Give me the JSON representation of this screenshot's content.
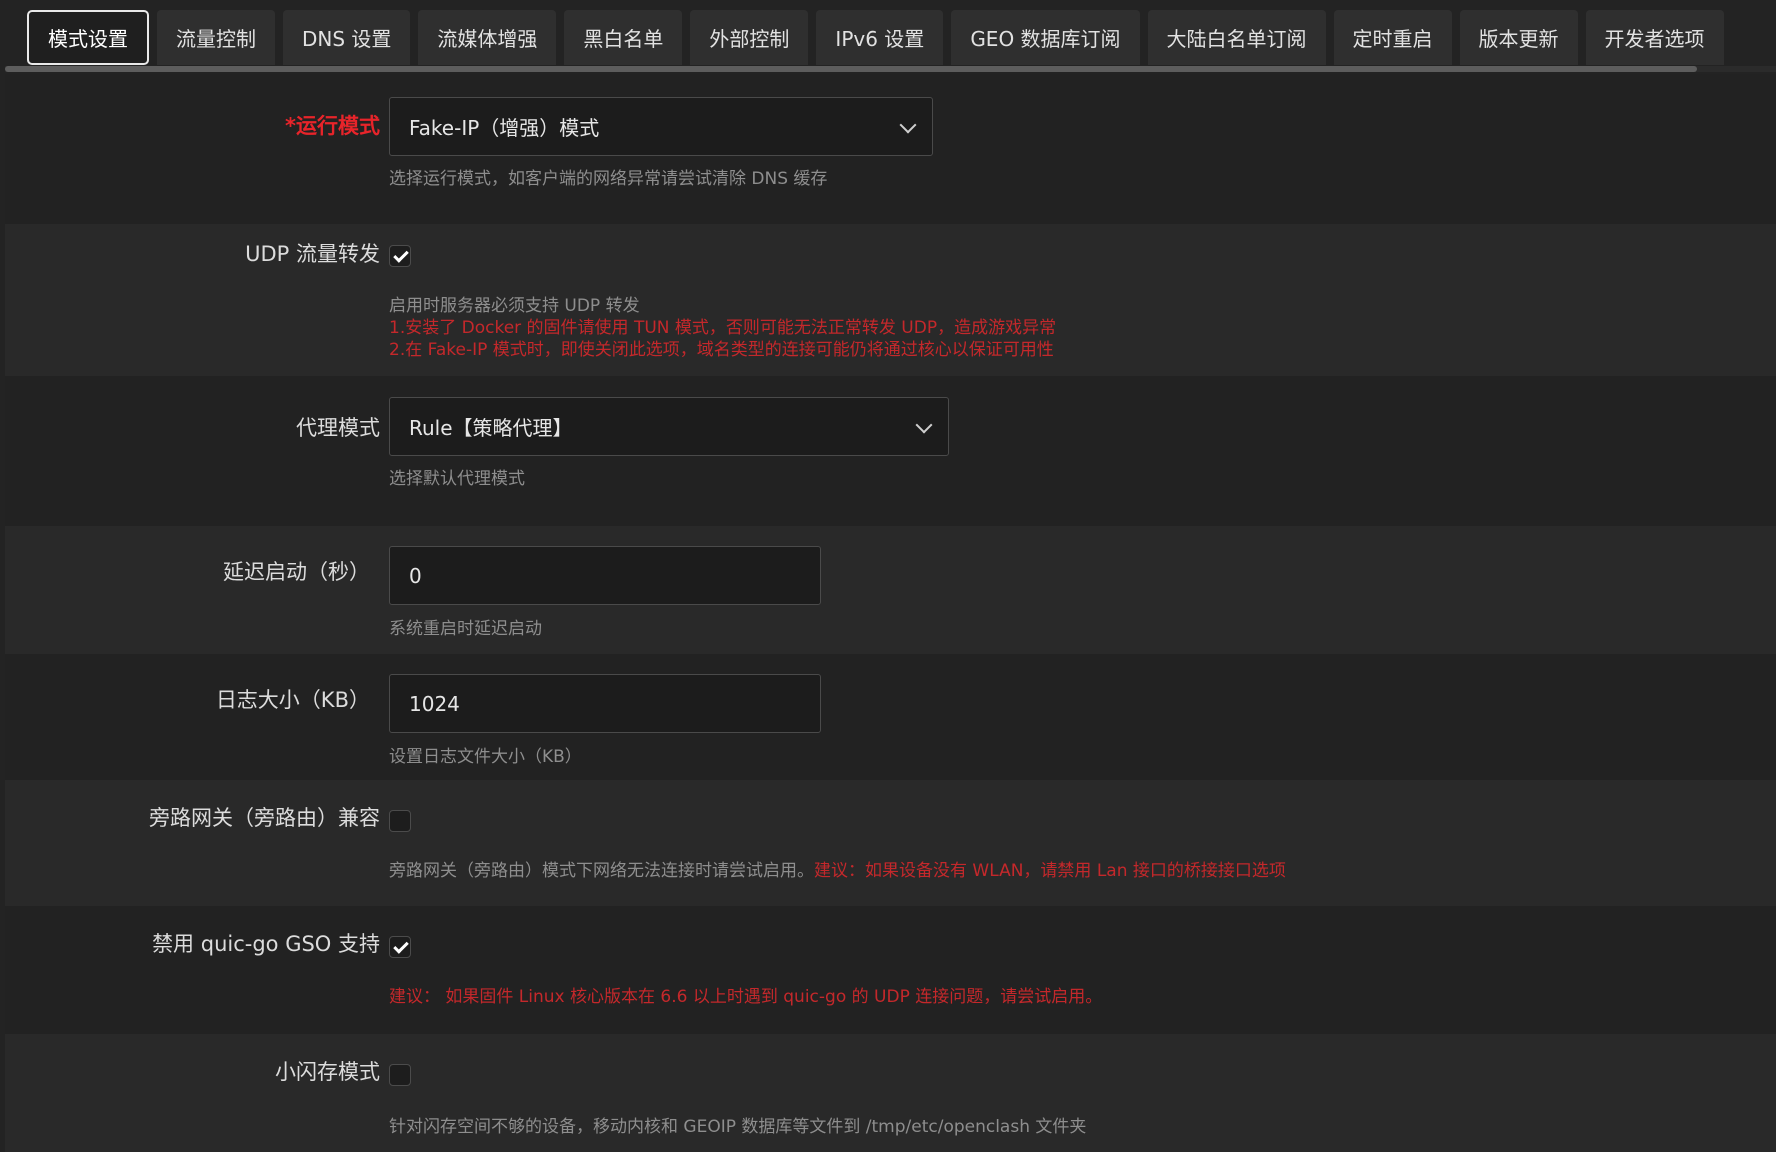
{
  "tabs": [
    {
      "label": "模式设置",
      "active": true
    },
    {
      "label": "流量控制",
      "active": false
    },
    {
      "label": "DNS 设置",
      "active": false
    },
    {
      "label": "流媒体增强",
      "active": false
    },
    {
      "label": "黑白名单",
      "active": false
    },
    {
      "label": "外部控制",
      "active": false
    },
    {
      "label": "IPv6 设置",
      "active": false
    },
    {
      "label": "GEO 数据库订阅",
      "active": false
    },
    {
      "label": "大陆白名单订阅",
      "active": false
    },
    {
      "label": "定时重启",
      "active": false
    },
    {
      "label": "版本更新",
      "active": false
    },
    {
      "label": "开发者选项",
      "active": false
    }
  ],
  "settings": {
    "run_mode": {
      "label": "*运行模式",
      "value": "Fake-IP（增强）模式",
      "desc": "选择运行模式，如客户端的网络异常请尝试清除 DNS 缓存"
    },
    "udp_forward": {
      "label": "UDP 流量转发",
      "checked": true,
      "desc": "启用时服务器必须支持 UDP 转发",
      "warn1": "1.安装了 Docker 的固件请使用 TUN 模式，否则可能无法正常转发 UDP，造成游戏异常",
      "warn2": "2.在 Fake-IP 模式时，即使关闭此选项，域名类型的连接可能仍将通过核心以保证可用性"
    },
    "proxy_mode": {
      "label": "代理模式",
      "value": "Rule【策略代理】",
      "desc": "选择默认代理模式"
    },
    "delay_start": {
      "label": "延迟启动（秒）",
      "value": "0",
      "desc": "系统重启时延迟启动"
    },
    "log_size": {
      "label": "日志大小（KB）",
      "value": "1024",
      "desc": "设置日志文件大小（KB）"
    },
    "bypass_gateway": {
      "label": "旁路网关（旁路由）兼容",
      "checked": false,
      "desc": "旁路网关（旁路由）模式下网络无法连接时请尝试启用。",
      "warn": "建议：如果设备没有 WLAN，请禁用 Lan 接口的桥接接口选项"
    },
    "disable_gso": {
      "label": "禁用 quic-go GSO 支持",
      "checked": true,
      "warn": "建议： 如果固件 Linux 核心版本在 6.6 以上时遇到 quic-go 的 UDP 连接问题，请尝试启用。"
    },
    "small_flash": {
      "label": "小闪存模式",
      "checked": false,
      "desc": "针对闪存空间不够的设备，移动内核和 GEOIP 数据库等文件到 /tmp/etc/openclash 文件夹"
    }
  },
  "colors": {
    "background": "#232323",
    "row_alt": "#292929",
    "accent_red": "#c4282b",
    "required_red": "#e8242a",
    "text": "#dcdcdc",
    "muted": "#8e8e8e"
  }
}
